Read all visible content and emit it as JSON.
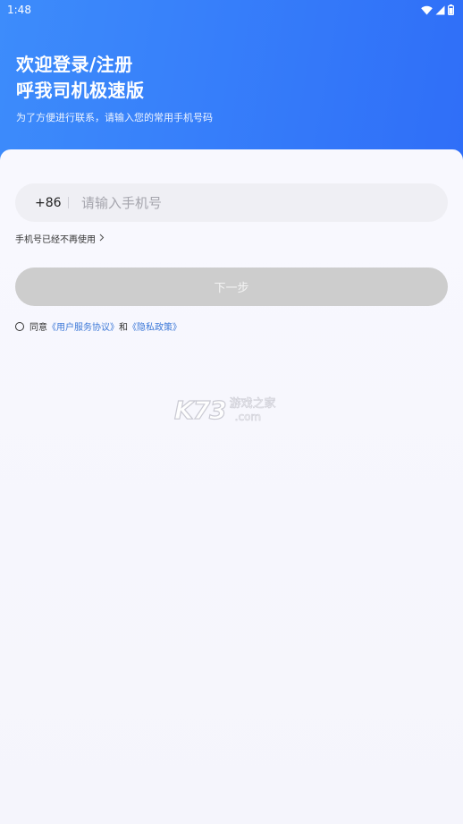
{
  "status_bar": {
    "time": "1:48"
  },
  "header": {
    "title_line1": "欢迎登录/注册",
    "title_line2": "呼我司机极速版",
    "subtitle": "为了方便进行联系，请输入您的常用手机号码"
  },
  "phone_field": {
    "country_code": "+86",
    "placeholder": "请输入手机号",
    "value": ""
  },
  "no_longer_link": {
    "label": "手机号已经不再使用",
    "icon": "chevron-right-icon"
  },
  "next_button": {
    "label": "下一步"
  },
  "agreement": {
    "prefix": "同意",
    "terms": "《用户服务协议》",
    "conjunction": "和",
    "privacy": "《隐私政策》"
  },
  "watermark": {
    "logo": "K73",
    "cn": "游戏之家",
    "com": ".com"
  },
  "colors": {
    "header_start": "#3d8cfb",
    "header_end": "#2f6ef8",
    "button_disabled": "#cdcdcd",
    "link": "#3c78d8"
  }
}
